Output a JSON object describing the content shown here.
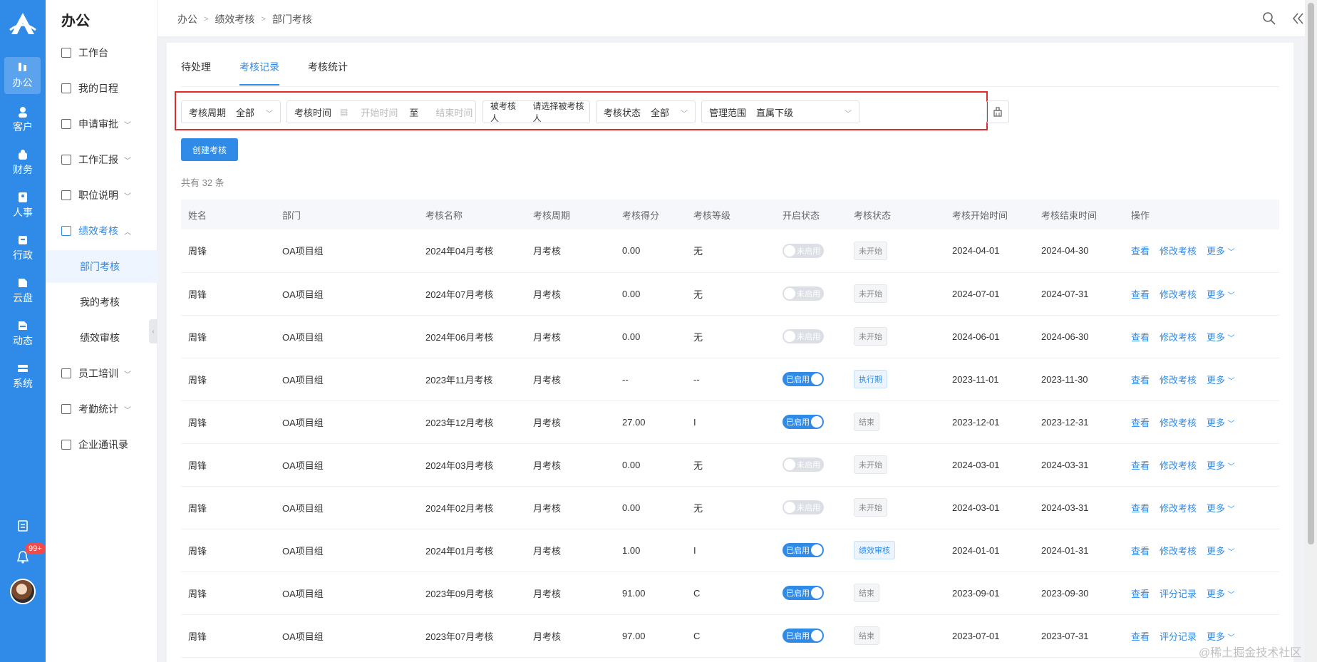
{
  "rail": {
    "items": [
      {
        "label": "办公",
        "icon": "office-icon",
        "active": true
      },
      {
        "label": "客户",
        "icon": "customer-icon"
      },
      {
        "label": "财务",
        "icon": "finance-icon"
      },
      {
        "label": "人事",
        "icon": "hr-icon"
      },
      {
        "label": "行政",
        "icon": "admin-icon"
      },
      {
        "label": "云盘",
        "icon": "cloud-disk-icon"
      },
      {
        "label": "动态",
        "icon": "activity-icon"
      },
      {
        "label": "系统",
        "icon": "system-icon"
      }
    ],
    "badge": "99+"
  },
  "sidebar": {
    "title": "办公",
    "items": [
      {
        "label": "工作台"
      },
      {
        "label": "我的日程"
      },
      {
        "label": "申请审批"
      },
      {
        "label": "工作汇报"
      },
      {
        "label": "职位说明"
      },
      {
        "label": "绩效考核"
      },
      {
        "label": "部门考核"
      },
      {
        "label": "我的考核"
      },
      {
        "label": "绩效审核"
      },
      {
        "label": "员工培训"
      },
      {
        "label": "考勤统计"
      },
      {
        "label": "企业通讯录"
      }
    ]
  },
  "breadcrumb": [
    "办公",
    "绩效考核",
    "部门考核"
  ],
  "tabs": [
    "待处理",
    "考核记录",
    "考核统计"
  ],
  "filters": {
    "period_label": "考核周期",
    "period_value": "全部",
    "time_label": "考核时间",
    "start_placeholder": "开始时间",
    "to": "至",
    "end_placeholder": "结束时间",
    "assessee_label": "被考核人",
    "assessee_placeholder": "请选择被考核人",
    "status_label": "考核状态",
    "status_value": "全部",
    "scope_label": "管理范围",
    "scope_value": "直属下级"
  },
  "create_button": "创建考核",
  "total": "共有 32 条",
  "table": {
    "headers": [
      "姓名",
      "部门",
      "考核名称",
      "考核周期",
      "考核得分",
      "考核等级",
      "开启状态",
      "考核状态",
      "考核开始时间",
      "考核结束时间",
      "操作"
    ],
    "rows": [
      {
        "name": "周锋",
        "dept": "OA项目组",
        "title": "2024年04月考核",
        "period": "月考核",
        "score": "0.00",
        "grade": "无",
        "enabled": "未启用",
        "status": "未开始",
        "start": "2024-04-01",
        "end": "2024-04-30",
        "op1": "查看",
        "op2": "修改考核",
        "more": "更多"
      },
      {
        "name": "周锋",
        "dept": "OA项目组",
        "title": "2024年07月考核",
        "period": "月考核",
        "score": "0.00",
        "grade": "无",
        "enabled": "未启用",
        "status": "未开始",
        "start": "2024-07-01",
        "end": "2024-07-31",
        "op1": "查看",
        "op2": "修改考核",
        "more": "更多"
      },
      {
        "name": "周锋",
        "dept": "OA项目组",
        "title": "2024年06月考核",
        "period": "月考核",
        "score": "0.00",
        "grade": "无",
        "enabled": "未启用",
        "status": "未开始",
        "start": "2024-06-01",
        "end": "2024-06-30",
        "op1": "查看",
        "op2": "修改考核",
        "more": "更多"
      },
      {
        "name": "周锋",
        "dept": "OA项目组",
        "title": "2023年11月考核",
        "period": "月考核",
        "score": "--",
        "grade": "--",
        "enabled": "已启用",
        "status": "执行期",
        "start": "2023-11-01",
        "end": "2023-11-30",
        "op1": "查看",
        "op2": "修改考核",
        "more": "更多"
      },
      {
        "name": "周锋",
        "dept": "OA项目组",
        "title": "2023年12月考核",
        "period": "月考核",
        "score": "27.00",
        "grade": "I",
        "enabled": "已启用",
        "status": "结束",
        "start": "2023-12-01",
        "end": "2023-12-31",
        "op1": "查看",
        "op2": "修改考核",
        "more": "更多"
      },
      {
        "name": "周锋",
        "dept": "OA项目组",
        "title": "2024年03月考核",
        "period": "月考核",
        "score": "0.00",
        "grade": "无",
        "enabled": "未启用",
        "status": "未开始",
        "start": "2024-03-01",
        "end": "2024-03-31",
        "op1": "查看",
        "op2": "修改考核",
        "more": "更多"
      },
      {
        "name": "周锋",
        "dept": "OA项目组",
        "title": "2024年02月考核",
        "period": "月考核",
        "score": "0.00",
        "grade": "无",
        "enabled": "未启用",
        "status": "未开始",
        "start": "2024-03-01",
        "end": "2024-03-31",
        "op1": "查看",
        "op2": "修改考核",
        "more": "更多"
      },
      {
        "name": "周锋",
        "dept": "OA项目组",
        "title": "2024年01月考核",
        "period": "月考核",
        "score": "1.00",
        "grade": "I",
        "enabled": "已启用",
        "status": "绩效审核",
        "start": "2024-01-01",
        "end": "2024-01-31",
        "op1": "查看",
        "op2": "修改考核",
        "more": "更多"
      },
      {
        "name": "周锋",
        "dept": "OA项目组",
        "title": "2023年09月考核",
        "period": "月考核",
        "score": "91.00",
        "grade": "C",
        "enabled": "已启用",
        "status": "结束",
        "start": "2023-09-01",
        "end": "2023-09-30",
        "op1": "查看",
        "op2": "评分记录",
        "more": "更多"
      },
      {
        "name": "周锋",
        "dept": "OA项目组",
        "title": "2023年07月考核",
        "period": "月考核",
        "score": "97.00",
        "grade": "C",
        "enabled": "已启用",
        "status": "结束",
        "start": "2023-07-01",
        "end": "2023-07-31",
        "op1": "查看",
        "op2": "评分记录",
        "more": "更多"
      }
    ]
  },
  "watermark": "@稀土掘金技术社区",
  "colors": {
    "primary": "#2f8ae8",
    "highlight": "#e02c2c"
  }
}
